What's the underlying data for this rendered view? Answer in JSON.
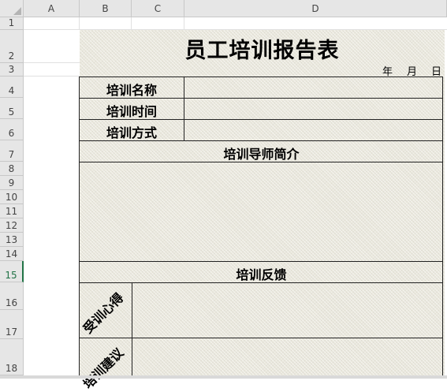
{
  "spreadsheet": {
    "column_headers": [
      "A",
      "B",
      "C",
      "D"
    ],
    "row_headers": [
      "1",
      "2",
      "3",
      "4",
      "5",
      "6",
      "7",
      "8",
      "9",
      "10",
      "11",
      "12",
      "13",
      "14",
      "15",
      "16",
      "17",
      "18"
    ],
    "selected_row": "15"
  },
  "form": {
    "title": "员工培训报告表",
    "date": {
      "year": "年",
      "month": "月",
      "day": "日"
    },
    "fields": {
      "training_name": "培训名称",
      "training_time": "培训时间",
      "training_method": "培训方式"
    },
    "mentor_section": "培训导师简介",
    "feedback_section": "培训反馈",
    "experience_label": "受训心得",
    "suggestion_label": "培训建议"
  }
}
